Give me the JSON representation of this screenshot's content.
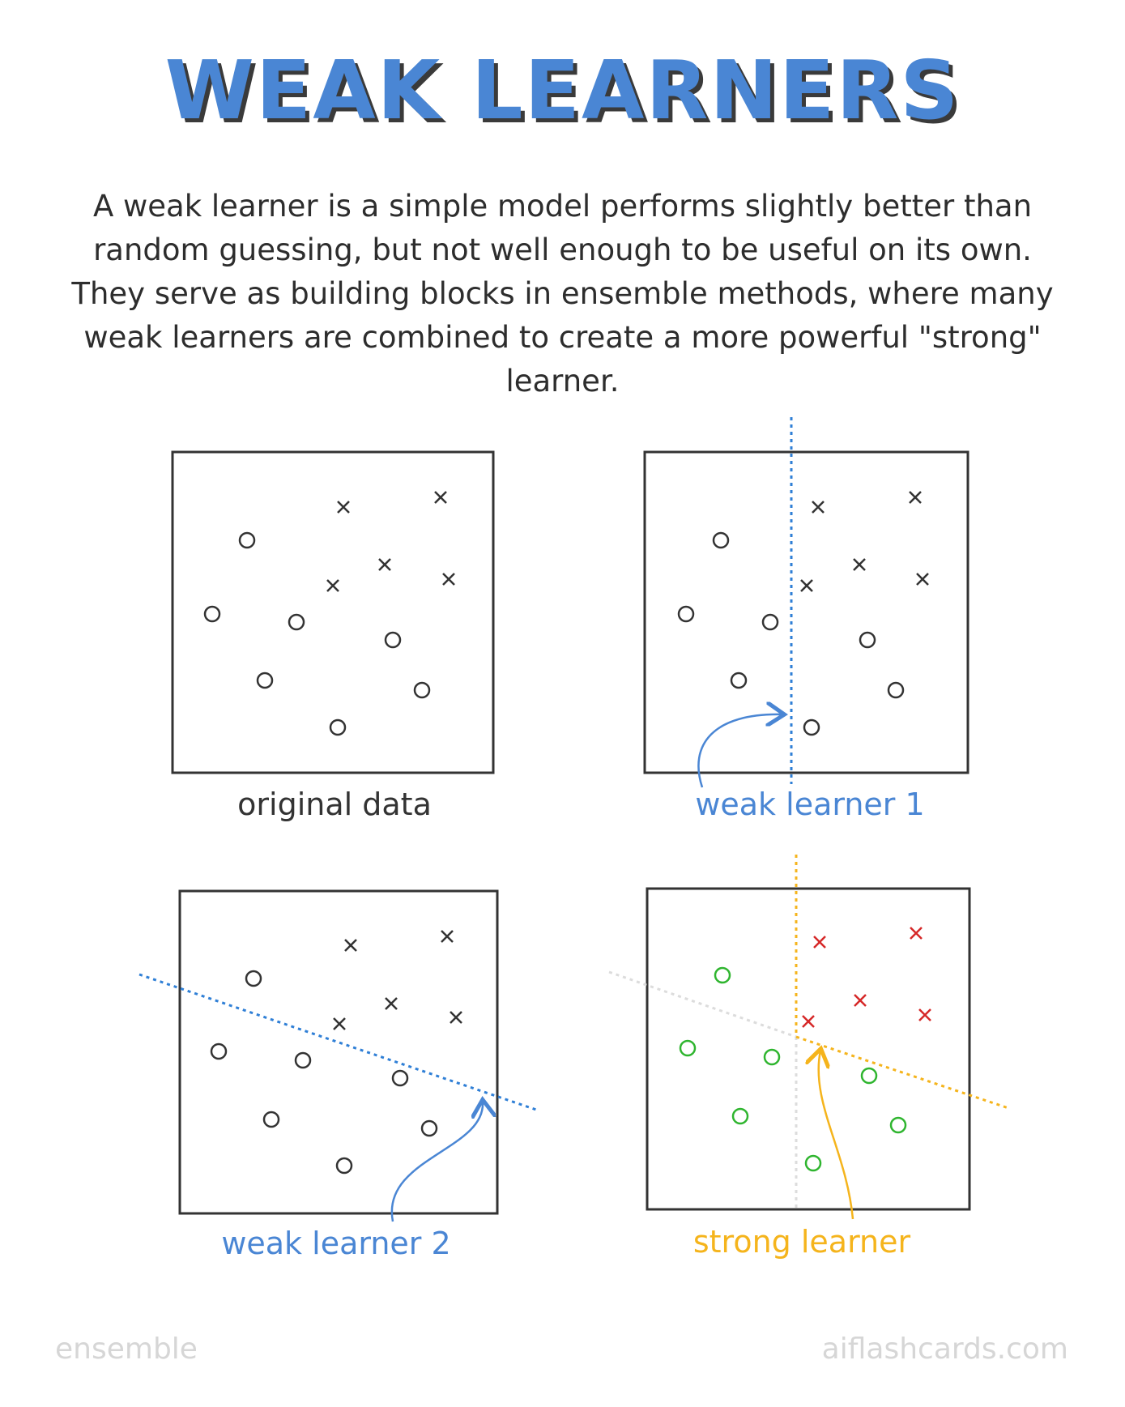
{
  "title": "WEAK LEARNERS",
  "intro": "A weak learner is a simple model performs slightly better than random guessing, but not  well enough to be useful on its own. They serve as building blocks in ensemble methods, where many weak learners are combined to create a more powerful \"strong\" learner.",
  "panels": {
    "original": {
      "caption": "original data"
    },
    "weak1": {
      "caption": "weak learner 1"
    },
    "weak2": {
      "caption": "weak learner 2"
    },
    "strong": {
      "caption": "strong learner"
    }
  },
  "colors": {
    "title": "#4a86d4",
    "blue": "#4a86d4",
    "dotted_blue": "#2f7fd6",
    "strong": "#f5b41c",
    "pos": "#d62828",
    "neg": "#2fb52f",
    "ink": "#333333",
    "faint": "#dcdcdc"
  },
  "footer": {
    "left": "ensemble",
    "right": "aiflashcards.com"
  }
}
